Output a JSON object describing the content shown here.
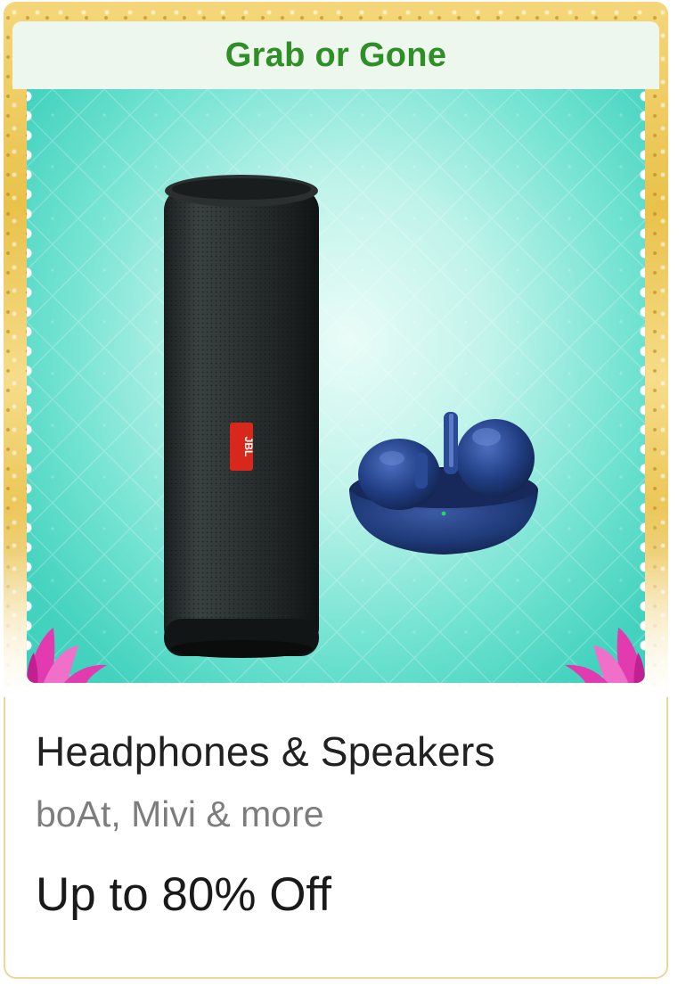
{
  "banner": {
    "label": "Grab or Gone",
    "label_color": "#2e8f26"
  },
  "product_images": {
    "speaker": {
      "icon": "bluetooth-speaker-icon",
      "brand_logo_text": "JBL",
      "logo_color": "#d8281c"
    },
    "earbuds": {
      "icon": "earbuds-case-icon",
      "color": "#1f3a78"
    }
  },
  "deal": {
    "category": "Headphones & Speakers",
    "brands": "boAt, Mivi & more",
    "offer": "Up to 80% Off"
  },
  "colors": {
    "hero_teal": "#45d3bf",
    "frame_gold": "#e9c24b",
    "lotus_pink": "#e23bb0"
  }
}
